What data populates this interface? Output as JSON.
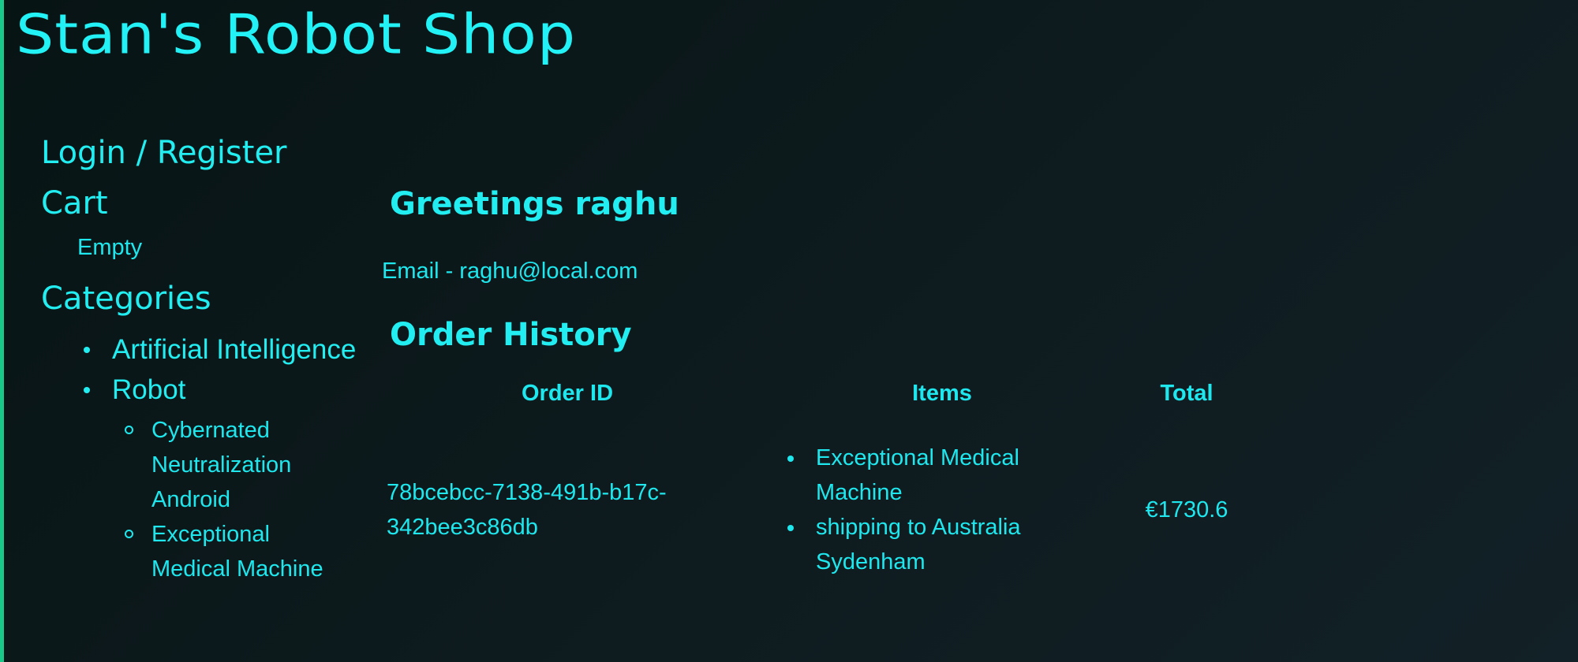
{
  "site": {
    "title": "Stan's Robot Shop"
  },
  "sidebar": {
    "login_label": "Login / Register",
    "cart_heading": "Cart",
    "cart_status": "Empty",
    "categories_heading": "Categories",
    "categories": [
      {
        "label": "Artificial Intelligence"
      },
      {
        "label": "Robot",
        "children": [
          {
            "label": "Cybernated Neutralization Android"
          },
          {
            "label": "Exceptional Medical Machine"
          }
        ]
      }
    ]
  },
  "main": {
    "greeting": "Greetings raghu",
    "email_line": "Email - raghu@local.com",
    "history_heading": "Order History",
    "table": {
      "headers": [
        "Order ID",
        "Items",
        "Total"
      ],
      "rows": [
        {
          "order_id": "78bcebcc-7138-491b-b17c-342bee3c86db",
          "items": [
            "Exceptional Medical Machine",
            "shipping to Australia Sydenham"
          ],
          "total": "€1730.6"
        }
      ]
    }
  },
  "colors": {
    "accent": "#22eef2",
    "border_left": "#18c98a",
    "background": "#0d1a1d"
  }
}
